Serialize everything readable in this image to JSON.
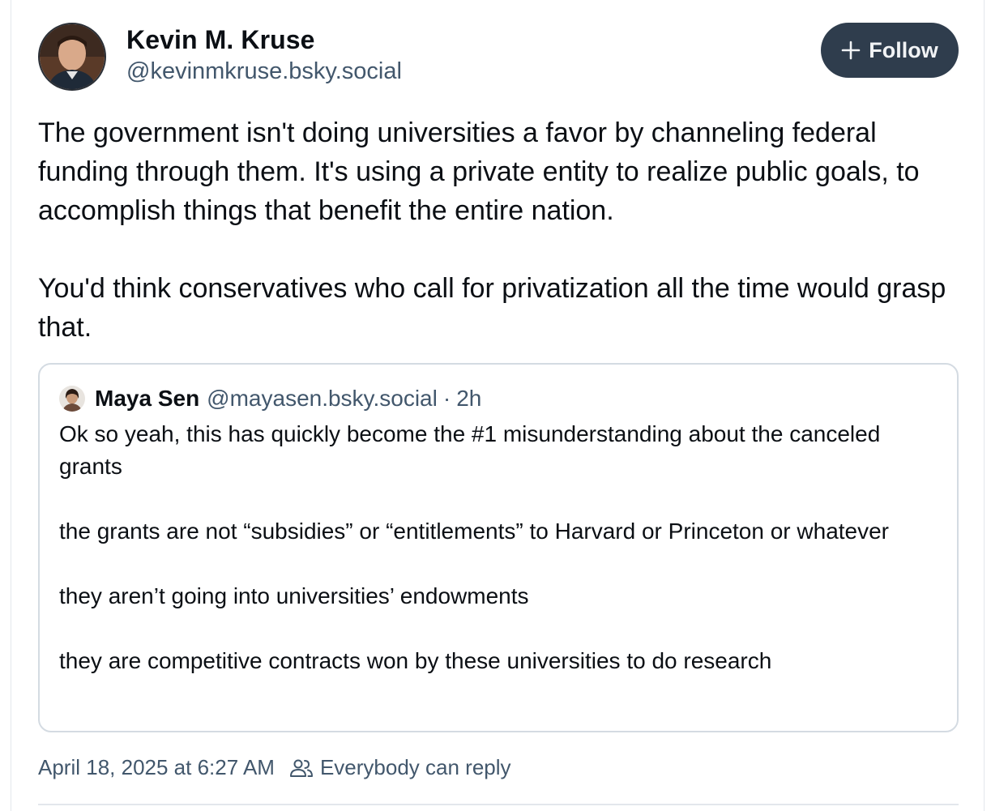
{
  "post": {
    "author": {
      "display_name": "Kevin M. Kruse",
      "handle": "@kevinmkruse.bsky.social"
    },
    "follow_label": "Follow",
    "paragraphs": [
      "The government isn't doing universities a favor by channeling federal funding through them. It's using a private entity to realize public goals, to accomplish things that benefit the entire nation.",
      "You'd think conservatives who call for privatization all the time would grasp that."
    ],
    "quote": {
      "display_name": "Maya Sen",
      "handle": "@mayasen.bsky.social",
      "separator": "·",
      "time": "2h",
      "paragraphs": [
        "Ok so yeah, this has quickly become the #1 misunderstanding about the canceled grants",
        "the grants are not “subsidies” or “entitlements” to Harvard or Princeton or whatever",
        "they aren’t going into universities’ endowments",
        "they are competitive contracts won by these universities to do research"
      ]
    },
    "timestamp": "April 18, 2025 at 6:27 AM",
    "reply_setting": "Everybody can reply"
  },
  "icons": {
    "follow": "plus-icon",
    "reply_setting": "people-icon"
  },
  "colors": {
    "follow_button_bg": "#2f3d4d",
    "secondary_text": "#42576c",
    "card_border": "#d4dbe2"
  }
}
